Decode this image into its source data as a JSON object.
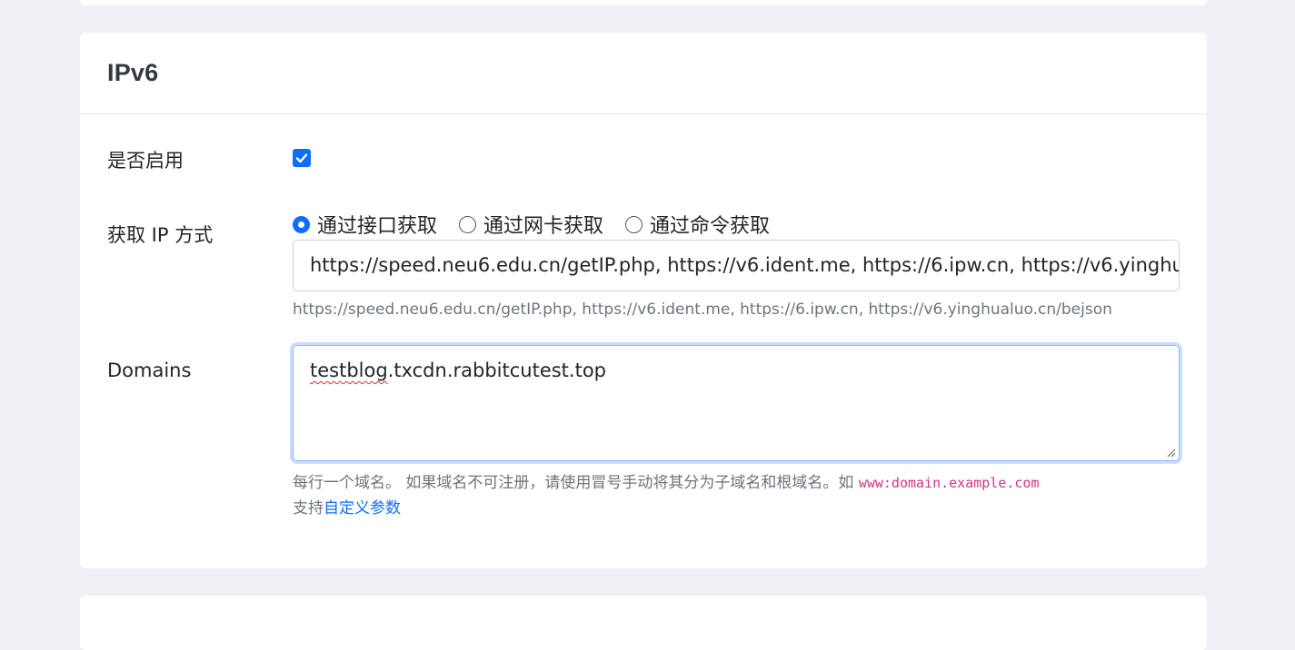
{
  "section": {
    "title": "IPv6"
  },
  "enable": {
    "label": "是否启用",
    "checked": true
  },
  "ip_method": {
    "label": "获取 IP 方式",
    "options": [
      {
        "label": "通过接口获取",
        "selected": true
      },
      {
        "label": "通过网卡获取",
        "selected": false
      },
      {
        "label": "通过命令获取",
        "selected": false
      }
    ],
    "url_value": "https://speed.neu6.edu.cn/getIP.php, https://v6.ident.me, https://6.ipw.cn, https://v6.yinghualuo.cn/bejson",
    "help": "https://speed.neu6.edu.cn/getIP.php, https://v6.ident.me, https://6.ipw.cn, https://v6.yinghualuo.cn/bejson"
  },
  "domains": {
    "label": "Domains",
    "value_word1": "testblog",
    "value_rest": ".txcdn.rabbitcutest.top",
    "help_line1": "每行一个域名。 如果域名不可注册，请使用冒号手动将其分为子域名和根域名。如",
    "help_code": "www:domain.example.com",
    "help_line2_prefix": "支持",
    "help_link": "自定义参数"
  },
  "colors": {
    "accent": "#0d6efd",
    "page_bg": "#eef0f4",
    "code": "#d63384"
  }
}
